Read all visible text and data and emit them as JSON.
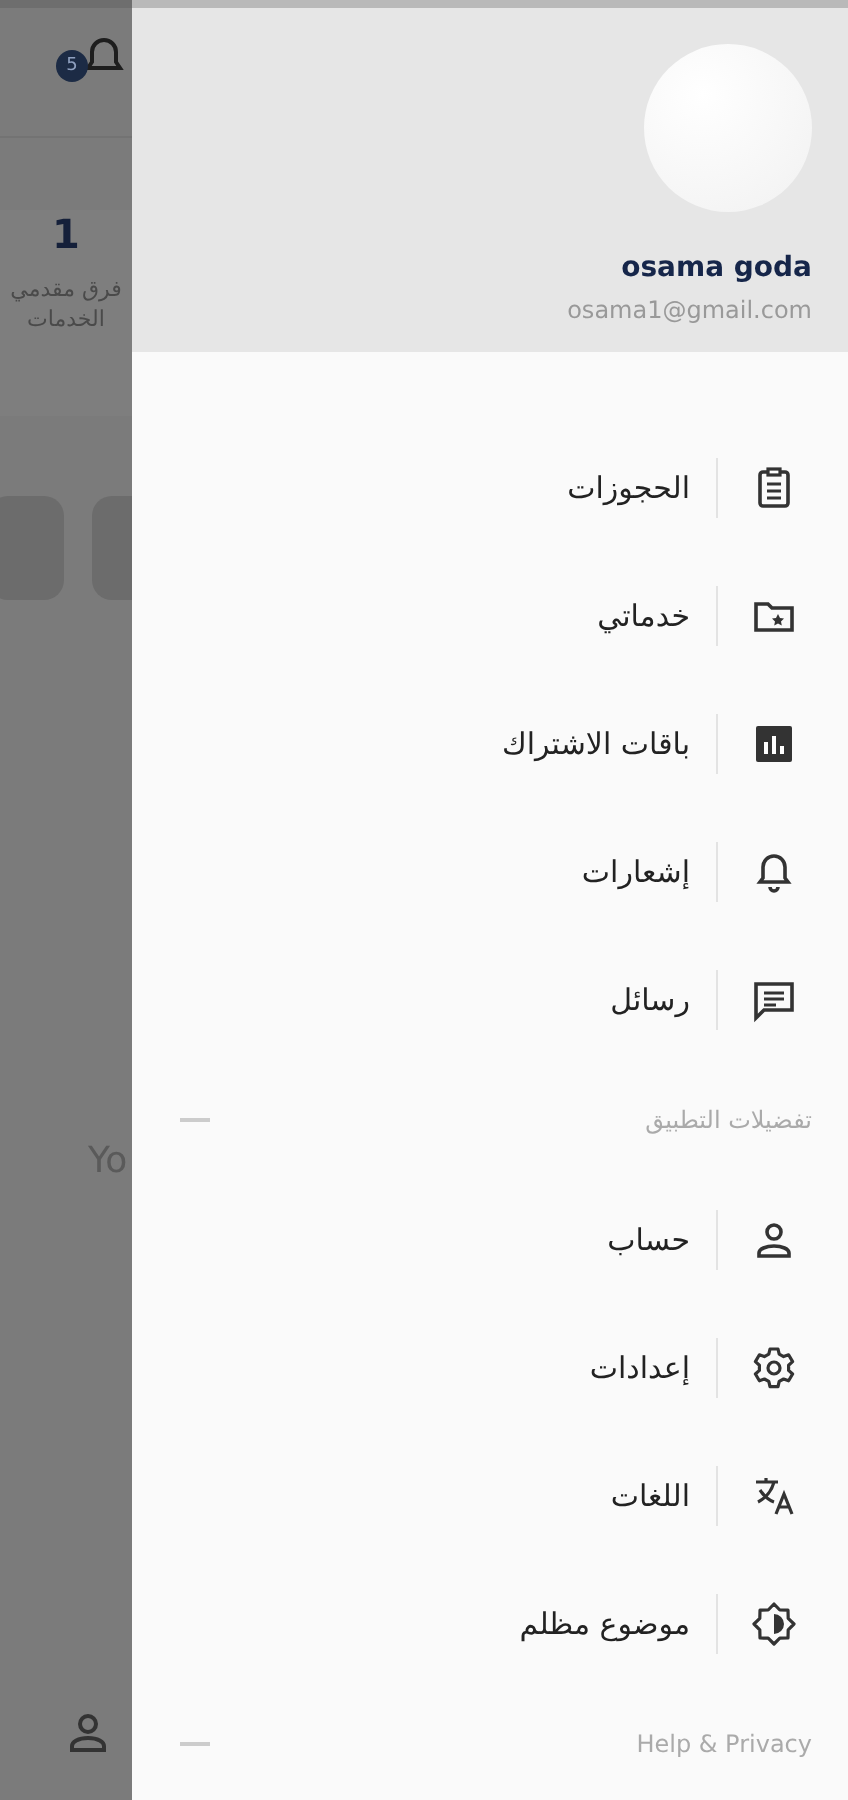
{
  "background": {
    "notification_badge": "5",
    "stat_value": "1",
    "stat_label_lines": [
      "فرق مقدمي",
      "الخدمات"
    ],
    "partial_text": "Yo"
  },
  "drawer": {
    "profile": {
      "name": "osama goda",
      "email": "osama1@gmail.com"
    },
    "sections": [
      {
        "items": [
          {
            "label": "الحجوزات"
          },
          {
            "label": "خدماتي"
          },
          {
            "label": "باقات الاشتراك"
          },
          {
            "label": "إشعارات"
          },
          {
            "label": "رسائل"
          }
        ]
      },
      {
        "title": "تفضيلات التطبيق",
        "items": [
          {
            "label": "حساب"
          },
          {
            "label": "إعدادات"
          },
          {
            "label": "اللغات"
          },
          {
            "label": "موضوع مظلم"
          }
        ]
      },
      {
        "title": "Help & Privacy"
      }
    ]
  }
}
